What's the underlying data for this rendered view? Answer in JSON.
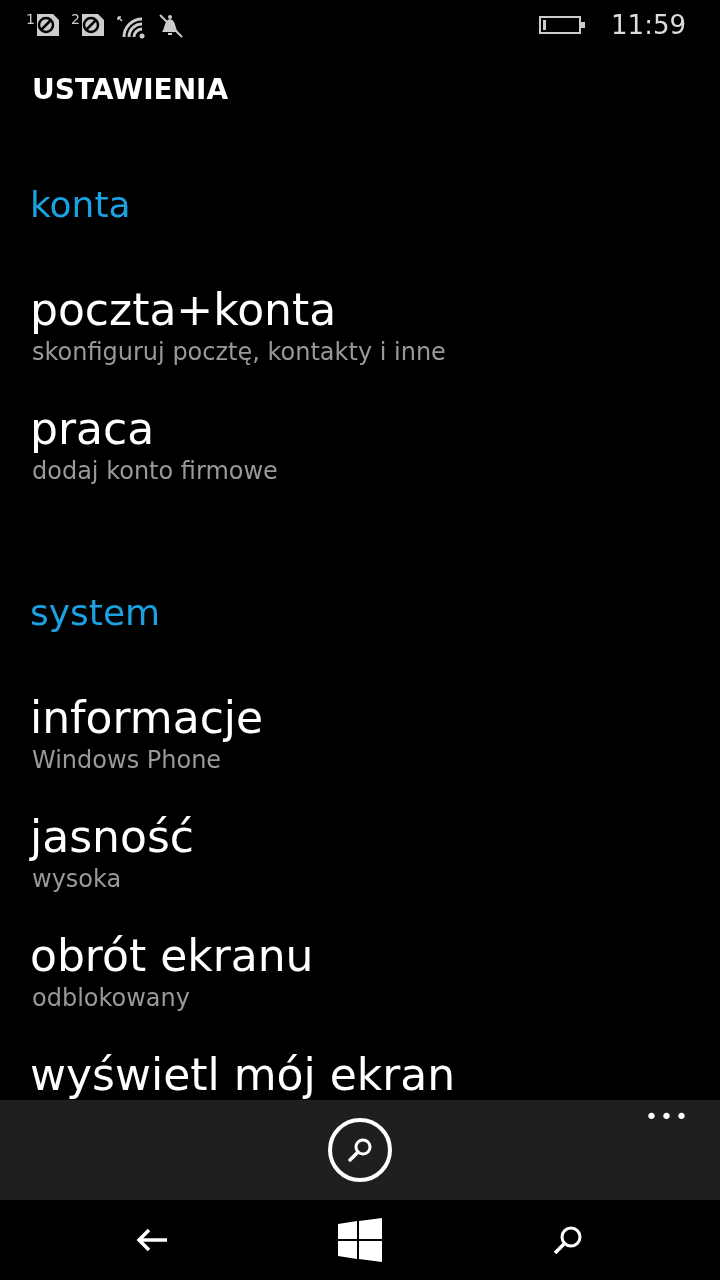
{
  "status_bar": {
    "sims": [
      {
        "label": "1"
      },
      {
        "label": "2"
      }
    ],
    "time": "11:59"
  },
  "title": "USTAWIENIA",
  "sections": [
    {
      "header": "konta",
      "items": [
        {
          "title": "poczta+konta",
          "subtitle": "skonfiguruj pocztę, kontakty i inne"
        },
        {
          "title": "praca",
          "subtitle": "dodaj konto firmowe"
        }
      ]
    },
    {
      "header": "system",
      "items": [
        {
          "title": "informacje",
          "subtitle": "Windows Phone"
        },
        {
          "title": "jasność",
          "subtitle": "wysoka"
        },
        {
          "title": "obrót ekranu",
          "subtitle": "odblokowany"
        },
        {
          "title": "wyświetl mój ekran"
        }
      ]
    }
  ],
  "app_bar": {
    "more": "•••"
  }
}
